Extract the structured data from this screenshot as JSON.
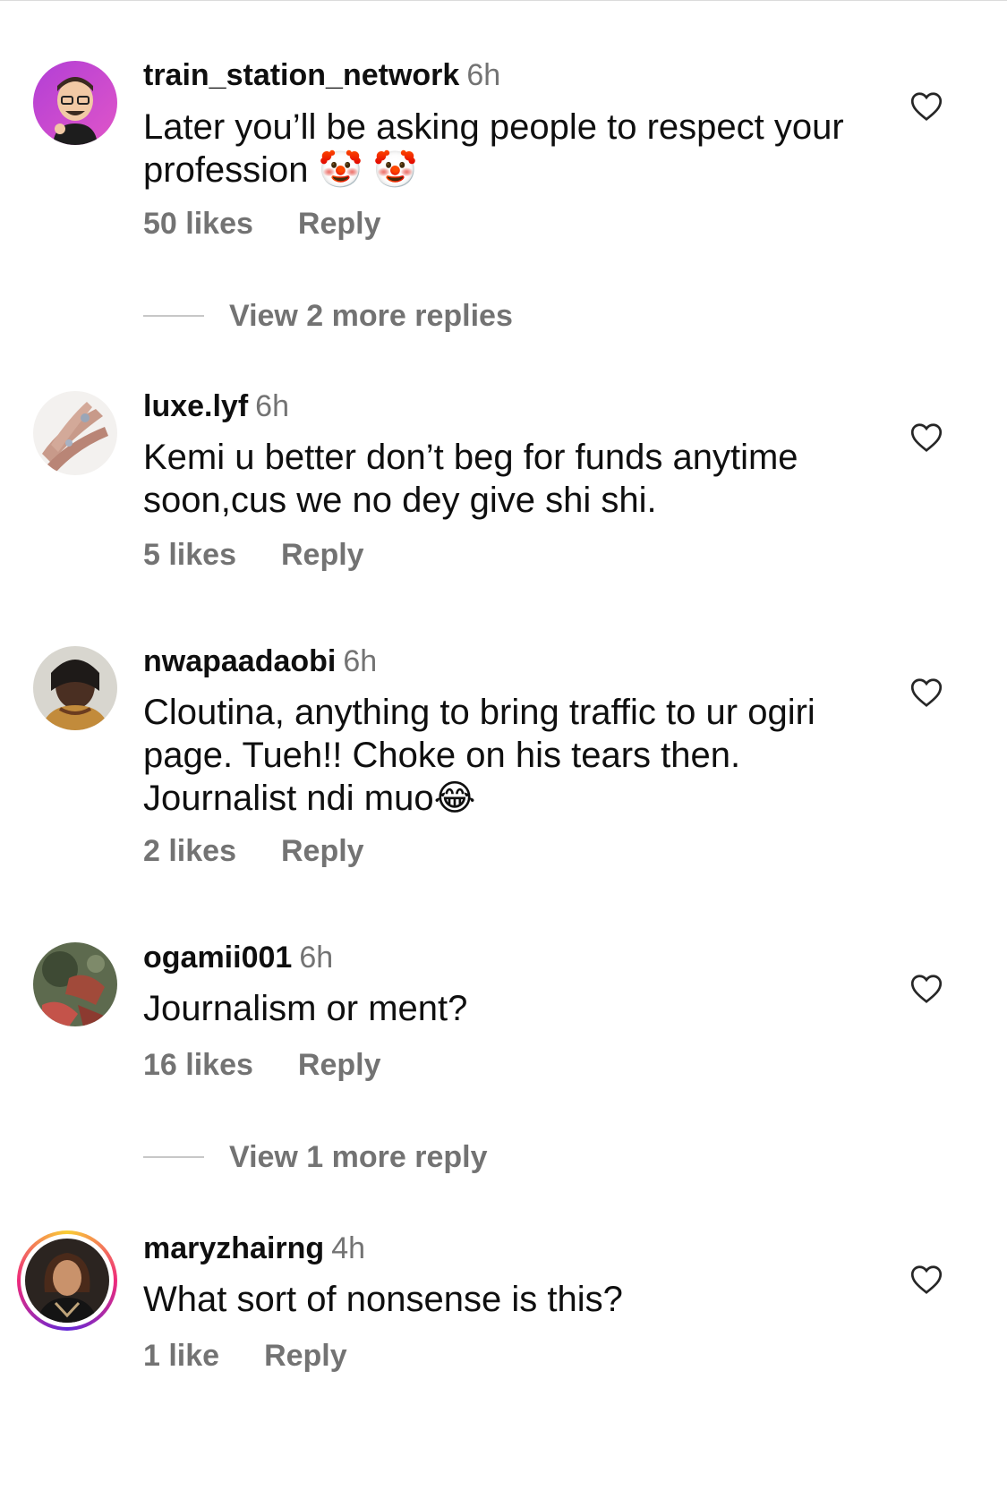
{
  "comments": [
    {
      "username": "train_station_network",
      "time": "6h",
      "text": "Later you’ll be asking people to respect your profession 🤡 🤡",
      "likes": "50 likes",
      "reply_label": "Reply",
      "view_more": "View 2 more replies"
    },
    {
      "username": "luxe.lyf",
      "time": "6h",
      "text": "Kemi u better don’t beg for funds anytime soon,cus we no dey give shi shi.",
      "likes": "5 likes",
      "reply_label": "Reply"
    },
    {
      "username": "nwapaadaobi",
      "time": "6h",
      "text": "Cloutina, anything to bring traffic to ur ogiri page. Tueh!! Choke on his tears then. Journalist ndi muo😂",
      "likes": "2 likes",
      "reply_label": "Reply"
    },
    {
      "username": "ogamii001",
      "time": "6h",
      "text": "Journalism or ment?",
      "likes": "16 likes",
      "reply_label": "Reply",
      "view_more": "View 1 more reply"
    },
    {
      "username": "maryzhairng",
      "time": "4h",
      "text": "What sort of nonsense is this?",
      "likes": "1 like",
      "reply_label": "Reply"
    }
  ],
  "icons": {
    "like": "heart-outline-icon"
  },
  "colors": {
    "text_primary": "#0f0f0f",
    "text_secondary": "#737373",
    "heart_stroke": "#262626"
  }
}
